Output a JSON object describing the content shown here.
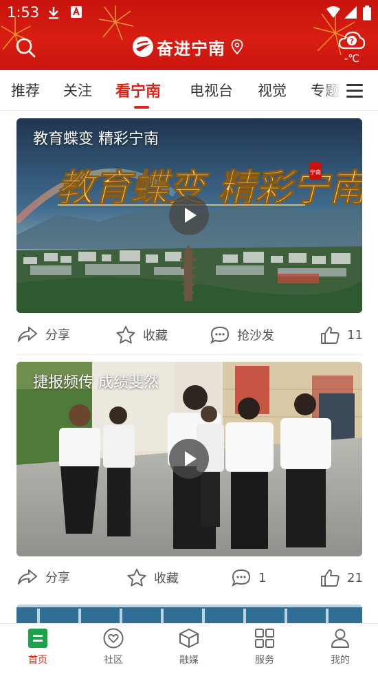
{
  "status": {
    "time": "1:53"
  },
  "header": {
    "app_name": "奋进宁南",
    "weather_temp": "-℃",
    "weather_icon": "cloud-unknown-icon",
    "colors": {
      "brand": "#d8261c",
      "header_bg": "#c8130d"
    }
  },
  "tabs": [
    {
      "label": "推荐",
      "active": false
    },
    {
      "label": "关注",
      "active": false
    },
    {
      "label": "看宁南",
      "active": true
    },
    {
      "label": "电视台",
      "active": false
    },
    {
      "label": "视觉",
      "active": false
    },
    {
      "label": "专题",
      "active": false
    }
  ],
  "cards": [
    {
      "title": "教育蝶变  精彩宁南",
      "calligraphy": "教育蝶变 精彩宁南",
      "stamp": "宁南",
      "share_label": "分享",
      "collect_label": "收藏",
      "comment_label": "抢沙发",
      "like_count": "11"
    },
    {
      "title": "捷报频传 成绩斐然",
      "share_label": "分享",
      "collect_label": "收藏",
      "comment_label": "1",
      "like_count": "21"
    }
  ],
  "bottom_nav": [
    {
      "label": "首页",
      "icon": "home-icon",
      "active": true
    },
    {
      "label": "社区",
      "icon": "community-heart-icon",
      "active": false
    },
    {
      "label": "融媒",
      "icon": "media-cube-icon",
      "active": false
    },
    {
      "label": "服务",
      "icon": "grid-services-icon",
      "active": false
    },
    {
      "label": "我的",
      "icon": "user-icon",
      "active": false
    }
  ]
}
